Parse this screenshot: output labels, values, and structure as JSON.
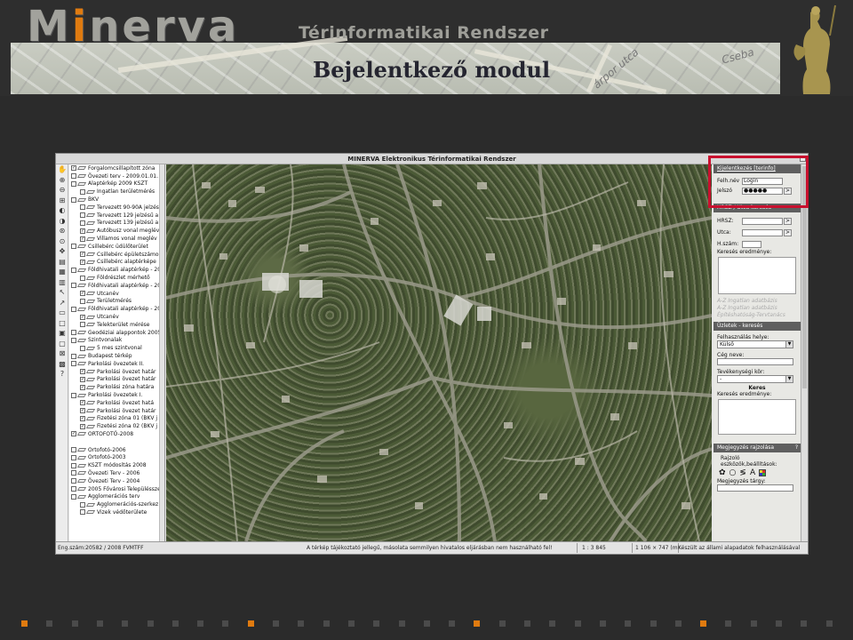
{
  "header": {
    "logo_prefix": "M",
    "logo_accent": "i",
    "logo_suffix": "nerva",
    "logo_subtitle": "Térinformatikai Rendszer",
    "slide_title": "Bejelentkező modul",
    "map_streets": [
      "árpor utca",
      "Cseba"
    ],
    "accent_color": "#e07b10"
  },
  "app": {
    "title": "MINERVA Elektronikus Térinformatikai Rendszer",
    "tool_icons": [
      "hand-icon",
      "zoom-in-icon",
      "zoom-out-icon",
      "zoom-rect-icon",
      "zoom-prev-icon",
      "zoom-next-icon",
      "zoom-full-icon",
      "zoom-layer-icon",
      "pan-icon",
      "measure-icon",
      "info-icon",
      "print-icon",
      "select-icon",
      "select-area-icon",
      "ruler-icon",
      "buffer-icon",
      "export-icon",
      "layer-icon",
      "clear-icon",
      "settings-icon",
      "help-icon"
    ],
    "tool_glyphs": [
      "✋",
      "⊕",
      "⊖",
      "⊞",
      "◐",
      "◑",
      "⊛",
      "⊙",
      "✥",
      "▤",
      "▦",
      "▥",
      "↖",
      "↗",
      "▭",
      "□",
      "▣",
      "▢",
      "⊠",
      "▩",
      "?"
    ],
    "layers": [
      {
        "label": "Forgalomcsillapított zóna",
        "indent": 0,
        "checked": true
      },
      {
        "label": "Övezeti terv - 2009.01.01.",
        "indent": 0,
        "checked": false
      },
      {
        "label": "Alaptérkép 2009 KSZT",
        "indent": 0,
        "checked": false
      },
      {
        "label": "Ingatlan területmérés",
        "indent": 1,
        "checked": false
      },
      {
        "label": "BKV",
        "indent": 0,
        "checked": false
      },
      {
        "label": "Tervezett 90-90A jelzésű",
        "indent": 1,
        "checked": false
      },
      {
        "label": "Tervezett 129 jelzésű a",
        "indent": 1,
        "checked": false
      },
      {
        "label": "Tervezett 139 jelzésű a",
        "indent": 1,
        "checked": false
      },
      {
        "label": "Autóbusz vonal meglév",
        "indent": 1,
        "checked": true
      },
      {
        "label": "Villamos vonal meglév",
        "indent": 1,
        "checked": true
      },
      {
        "label": "Csillebérc üdülőterület",
        "indent": 0,
        "checked": false
      },
      {
        "label": "Csillebérc épületszámo",
        "indent": 1,
        "checked": true
      },
      {
        "label": "Csillebérc alaptérképe",
        "indent": 1,
        "checked": true
      },
      {
        "label": "Földhivatali alaptérkép - 20",
        "indent": 0,
        "checked": false
      },
      {
        "label": "Földrészlet mérhető",
        "indent": 1,
        "checked": false
      },
      {
        "label": "Földhivatali alaptérkép - 20",
        "indent": 0,
        "checked": false
      },
      {
        "label": "Utcanév",
        "indent": 1,
        "checked": true
      },
      {
        "label": "Területmérés",
        "indent": 1,
        "checked": false
      },
      {
        "label": "Földhivatali alaptérkép - 20",
        "indent": 0,
        "checked": false
      },
      {
        "label": "Utcanév",
        "indent": 1,
        "checked": true
      },
      {
        "label": "Telekterület mérése",
        "indent": 1,
        "checked": false
      },
      {
        "label": "Geodéziai alappontok 2005",
        "indent": 0,
        "checked": false
      },
      {
        "label": "Szintvonalak",
        "indent": 0,
        "checked": false
      },
      {
        "label": "5 mes szintvonal",
        "indent": 1,
        "checked": false
      },
      {
        "label": "Budapest térkép",
        "indent": 0,
        "checked": false
      },
      {
        "label": "Parkolási övezetek II.",
        "indent": 0,
        "checked": false
      },
      {
        "label": "Parkolási övezet határ",
        "indent": 1,
        "checked": true
      },
      {
        "label": "Parkolási övezet határ",
        "indent": 1,
        "checked": true
      },
      {
        "label": "Parkolási zóna határa",
        "indent": 1,
        "checked": true
      },
      {
        "label": "Parkolási övezetek I.",
        "indent": 0,
        "checked": false
      },
      {
        "label": "Parkolási övezet hatá",
        "indent": 1,
        "checked": true
      },
      {
        "label": "Parkolási övezet határ",
        "indent": 1,
        "checked": true
      },
      {
        "label": "Fizetési zóna 01 (BKV j",
        "indent": 1,
        "checked": true
      },
      {
        "label": "Fizetési zóna 02 (BKV j",
        "indent": 1,
        "checked": true
      },
      {
        "label": "ORTOFOTÓ-2008",
        "indent": 0,
        "checked": true
      },
      {
        "label": "",
        "indent": 0,
        "checked": false,
        "gap": true
      },
      {
        "label": "Ortofotó-2006",
        "indent": 0,
        "checked": false
      },
      {
        "label": "Ortofotó-2003",
        "indent": 0,
        "checked": false
      },
      {
        "label": "KSZT módosítás 2008",
        "indent": 0,
        "checked": false
      },
      {
        "label": "Övezeti Terv - 2006",
        "indent": 0,
        "checked": false
      },
      {
        "label": "Övezeti Terv - 2004",
        "indent": 0,
        "checked": false
      },
      {
        "label": "2005 Fővárosi Településszerk",
        "indent": 0,
        "checked": false
      },
      {
        "label": "Agglomerációs terv",
        "indent": 0,
        "checked": false
      },
      {
        "label": "Agglomerációs-szerkez",
        "indent": 1,
        "checked": false
      },
      {
        "label": "Vizek védőterülete",
        "indent": 1,
        "checked": false
      }
    ],
    "login": {
      "header": "Kijelentkezés [terinfo]",
      "user_label": "Felh.név",
      "user_value": "Login",
      "pass_label": "Jelszó",
      "pass_value": "●●●●●",
      "go": ">"
    },
    "hrsz": {
      "header": "HRSZ / Utca keresés",
      "hrsz_label": "HRSZ:",
      "street_label": "Utca:",
      "house_label": "H.szám:",
      "results_label": "Keresés eredménye:",
      "go": ">",
      "faint_links": [
        "A-Z Ingatlan adatbázis",
        "A-Z Ingatlan adatbázis",
        "Építéshatóság-Tervtanács"
      ]
    },
    "uzletek": {
      "header": "Üzletek - keresés",
      "usage_label": "Felhasználás helye:",
      "usage_value": "Külső",
      "company_label": "Cég neve:",
      "activity_label": "Tevékenységi kör:",
      "activity_value": "-",
      "search_button": "Keres",
      "results_label": "Keresés eredménye:"
    },
    "megjegyzes": {
      "header": "Megjegyzés rajzolása",
      "help": "?",
      "tools_label_1": "Rajzoló",
      "tools_label_2": "eszközök,beállítások:",
      "subject_label": "Megjegyzés tárgy:"
    },
    "status": {
      "left": "Eng.szám:20582 / 2008 FVMTFF",
      "notice": "A térkép tájékoztató jellegű, másolata semmilyen hivatalos eljárásban nem használható fel!",
      "scale": "1 : 3 845",
      "size": "1 106 × 747 (m)",
      "right": "Készült az állami alapadatok felhasználásával"
    },
    "highlight_color": "#c8102e"
  },
  "footer": {
    "dot_count": 33,
    "active_dots": [
      0,
      9,
      18,
      27
    ]
  }
}
